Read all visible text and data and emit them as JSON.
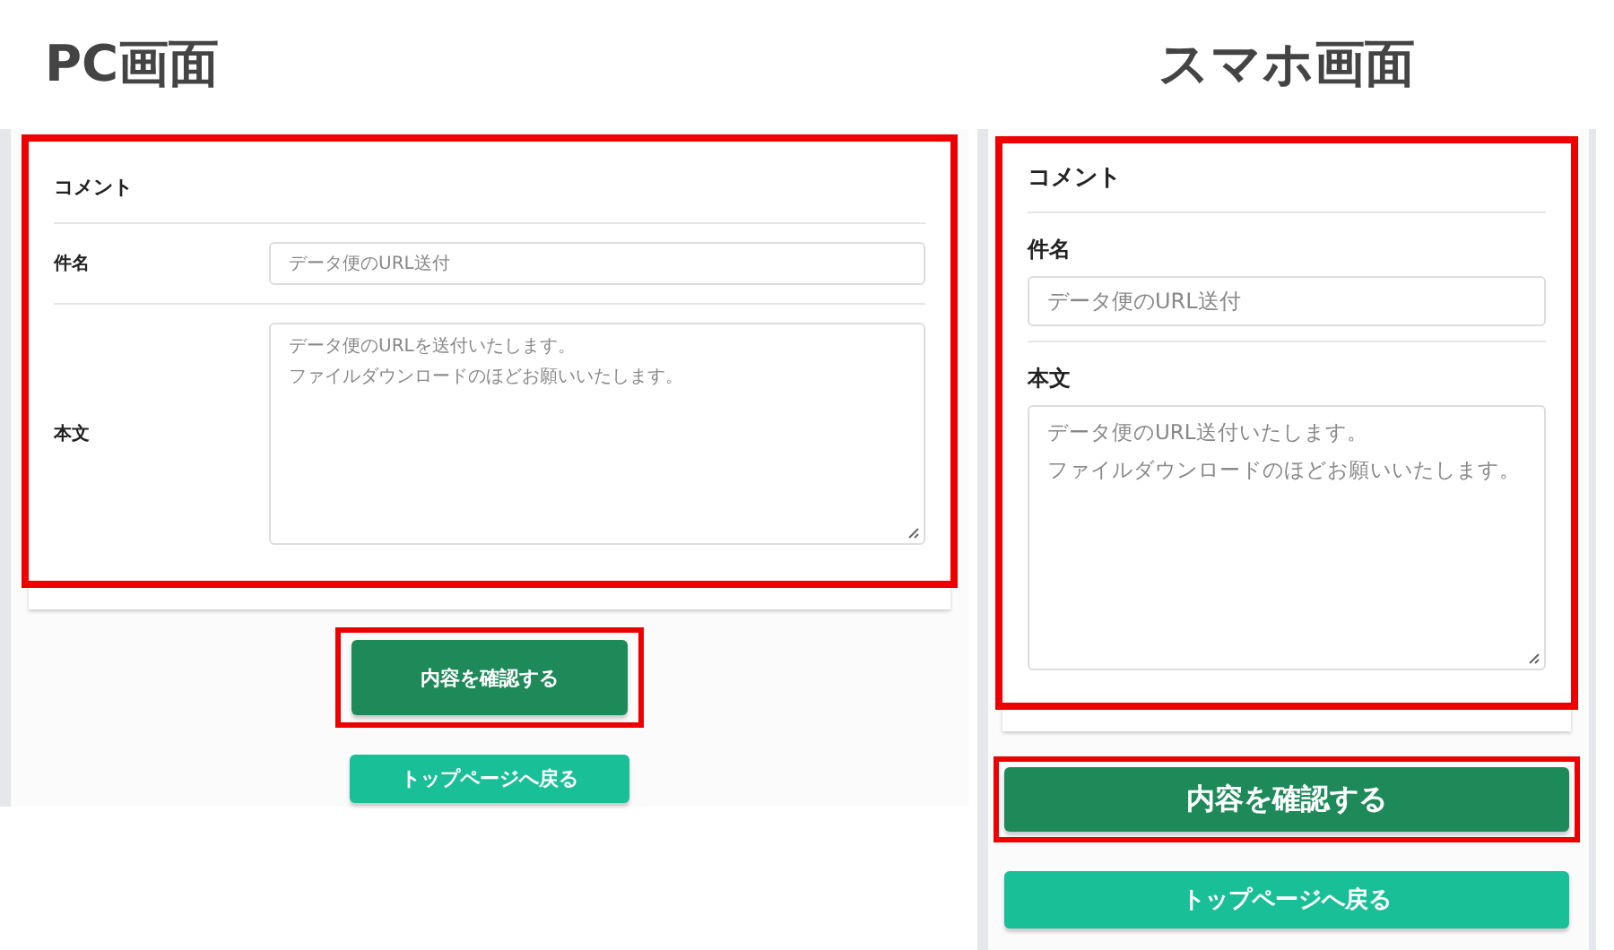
{
  "panels": [
    {
      "heading": "PC画面",
      "kind": "desktop",
      "card_highlighted": true,
      "section_title": "コメント",
      "fields": [
        {
          "label": "件名",
          "kind": "text",
          "placeholder": "データ便のURL送付"
        },
        {
          "label": "本文",
          "kind": "textarea",
          "placeholder_lines": [
            "データ便のURLを送付いたします。",
            "ファイルダウンロードのほどお願いいたします。"
          ]
        }
      ],
      "buttons": [
        {
          "label": "内容を確認する",
          "kind": "primary",
          "highlighted": true
        },
        {
          "label": "トップページへ戻る",
          "kind": "secondary",
          "highlighted": false
        }
      ]
    },
    {
      "heading": "スマホ画面",
      "kind": "mobile",
      "card_highlighted": true,
      "section_title": "コメント",
      "fields": [
        {
          "label": "件名",
          "kind": "text",
          "placeholder": "データ便のURL送付"
        },
        {
          "label": "本文",
          "kind": "textarea",
          "placeholder_lines": [
            "データ便のURL送付いたします。",
            "ファイルダウンロードのほどお願いいたします。"
          ]
        }
      ],
      "buttons": [
        {
          "label": "内容を確認する",
          "kind": "primary",
          "highlighted": true
        },
        {
          "label": "トップページへ戻る",
          "kind": "secondary",
          "highlighted": false
        }
      ]
    }
  ]
}
